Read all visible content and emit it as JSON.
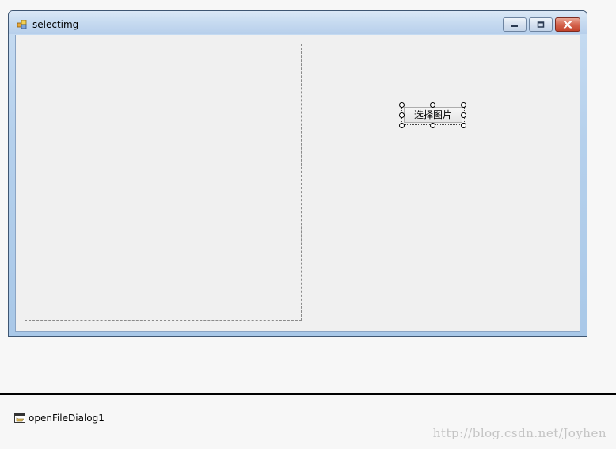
{
  "window": {
    "title": "selectimg",
    "icon": "form-icon",
    "caption_buttons": [
      "minimize-icon",
      "maximize-icon",
      "close-icon"
    ]
  },
  "form": {
    "picturebox": {
      "icon": "none"
    },
    "select_button": {
      "label": "选择图片"
    }
  },
  "tray": {
    "components": [
      {
        "label": "openFileDialog1",
        "icon": "open-file-dialog-icon"
      }
    ]
  },
  "watermark": "http://blog.csdn.net/Joyhen",
  "colors": {
    "title_bar": "#c6daf0",
    "client_background": "#f0f0f0",
    "close_button": "#c9503a",
    "tray_background": "#f7f7f7"
  }
}
